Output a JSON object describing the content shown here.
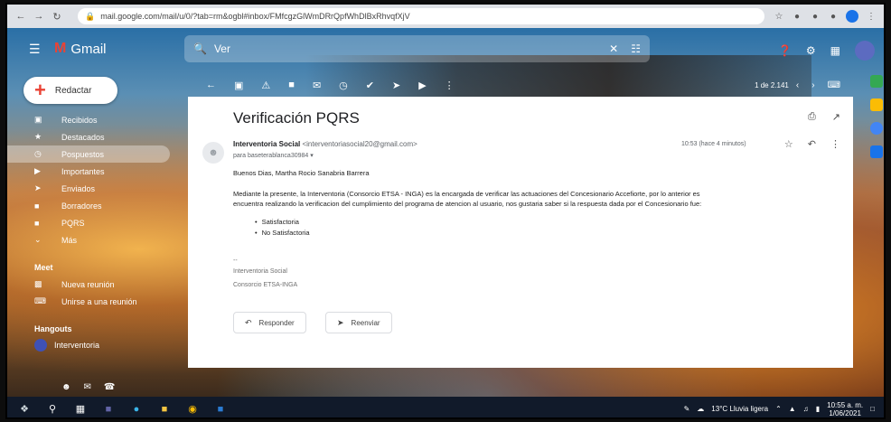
{
  "browser": {
    "url": "mail.google.com/mail/u/0/?tab=rm&ogbl#inbox/FMfcgzGlWmDRrQpfWhDlBxRhvqfXjV"
  },
  "header": {
    "app_name": "Gmail",
    "search_query": "Ver"
  },
  "sidebar": {
    "compose_label": "Redactar",
    "items": [
      {
        "label": "Recibidos",
        "icon": "inbox-icon",
        "active": false
      },
      {
        "label": "Destacados",
        "icon": "star-icon",
        "active": false
      },
      {
        "label": "Pospuestos",
        "icon": "clock-icon",
        "active": true
      },
      {
        "label": "Importantes",
        "icon": "label-icon",
        "active": false
      },
      {
        "label": "Enviados",
        "icon": "send-icon",
        "active": false
      },
      {
        "label": "Borradores",
        "icon": "draft-icon",
        "active": false
      },
      {
        "label": "PQRS",
        "icon": "label-icon",
        "active": false
      },
      {
        "label": "Más",
        "icon": "chevron-down-icon",
        "active": false
      }
    ],
    "meet_title": "Meet",
    "meet_items": [
      "Nueva reunión",
      "Unirse a una reunión"
    ],
    "hangouts_title": "Hangouts",
    "hangouts_user": "Interventoria"
  },
  "toolbar": {
    "pager": "1 de 2.141"
  },
  "message": {
    "subject": "Verificación PQRS",
    "sender_name": "Interventoria Social",
    "sender_email": "<interventoriasocial20@gmail.com>",
    "to": "para baseterablanca30984",
    "time": "10:53 (hace 4 minutos)",
    "greeting": "Buenos Dias, Martha Rocio Sanabria Barrera",
    "paragraph_1": "Mediante la presente, la  Interventoria (Consorcio ETSA - INGA) es la encargada de verificar las actuaciones del Concesionario Accefiorte, por lo anterior  es",
    "paragraph_2": "encuentra realizando la verificacion del cumplimiento del programa de atencion al usuario, nos gustaria saber si la respuesta dada por el Concesionario fue:",
    "options": [
      "Satisfactoria",
      "No Satisfactoria"
    ],
    "sig_sep": "--",
    "sig_name": "Interventoria Social",
    "sig_company": "Consorcio ETSA-INGA",
    "reply_label": "Responder",
    "forward_label": "Reenviar"
  },
  "taskbar": {
    "weather": "13°C  Lluvia ligera",
    "time": "10:55 a. m.",
    "date": "1/06/2021"
  }
}
